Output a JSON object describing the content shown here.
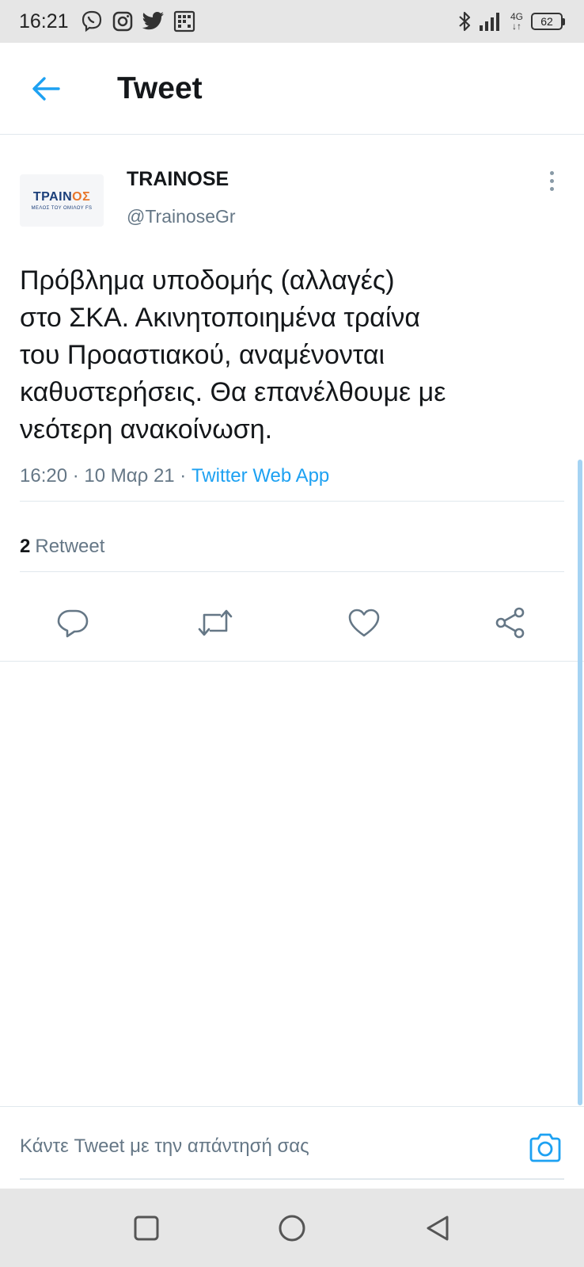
{
  "status_bar": {
    "time": "16:21",
    "left_icons": [
      "viber-icon",
      "instagram-icon",
      "twitter-icon",
      "app-grid-icon"
    ],
    "right_icons": [
      "bluetooth-icon",
      "signal-icon",
      "network-4g-icon"
    ],
    "network_top": "4G",
    "network_bottom": "↓↑",
    "battery": "62"
  },
  "header": {
    "title": "Tweet",
    "back_icon": "arrow-left-icon"
  },
  "author": {
    "name": "TRAINOSE",
    "handle": "@TrainoseGr",
    "avatar_brand_main": "TPAIN",
    "avatar_brand_accent": "OΣ",
    "avatar_sub": "ΜΕΛΟΣ ΤΟΥ ΟΜΙΛΟΥ FS"
  },
  "tweet": {
    "lines": [
      "Πρόβλημα υποδομής (αλλαγές)",
      "στο ΣΚΑ. Ακινητοποιημένα τραίνα",
      "του Προαστιακού, αναμένονται",
      "καθυστερήσεις. Θα επανέλθουμε με",
      "νεότερη ανακοίνωση."
    ],
    "meta_time": "16:20 · 10 Μαρ 21 · ",
    "meta_source": "Twitter Web App"
  },
  "stats": {
    "retweet_count": "2",
    "retweet_label": "Retweet"
  },
  "actions": [
    "reply-icon",
    "retweet-icon",
    "like-icon",
    "share-icon"
  ],
  "reply": {
    "placeholder": "Κάντε Tweet με την απάντησή σας"
  },
  "colors": {
    "accent": "#1da1f2",
    "text_primary": "#14171a",
    "text_secondary": "#657786",
    "bar_background": "#e6e6e6"
  }
}
